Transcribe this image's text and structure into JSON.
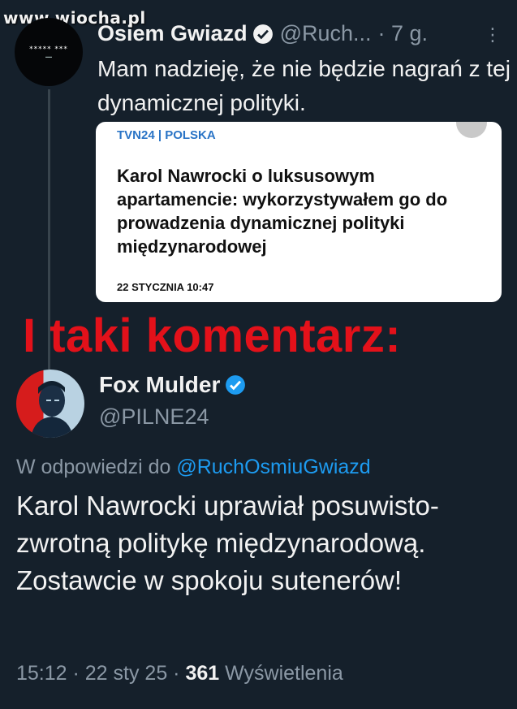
{
  "watermark": "www.wiocha.pl",
  "top_tweet": {
    "avatar_text": "***** ***",
    "name": "Osiem Gwiazd",
    "handle": "@Ruch...",
    "time": "· 7 g.",
    "more": "⋮",
    "text": "Mam nadzieję, że nie będzie nagrań z tej dynamicznej polityki.",
    "card": {
      "source": "TVN24 | POLSKA",
      "title": "Karol Nawrocki o luksusowym apartamencie: wykorzystywałem go do prowadzenia dynamicznej polityki międzynarodowej",
      "date": "22 STYCZNIA 10:47"
    }
  },
  "overlay": "I taki komentarz:",
  "reply_tweet": {
    "name": "Fox Mulder",
    "handle": "@PILNE24",
    "reply_prefix": "W odpowiedzi do",
    "reply_handle": "@RuchOsmiuGwiazd",
    "text": "Karol Nawrocki uprawiał posuwisto-zwrotną politykę międzynarodową. Zostawcie w spokoju sutenerów!",
    "time": "15:12 · 22 sty 25 ·",
    "views_count": "361",
    "views_label": "Wyświetlenia"
  },
  "colors": {
    "background": "#15202b",
    "link": "#1d9bf0",
    "overlay_red": "#e3111a",
    "muted": "#8b98a5"
  },
  "icons": [
    "verified-badge-icon",
    "more-options-icon"
  ]
}
